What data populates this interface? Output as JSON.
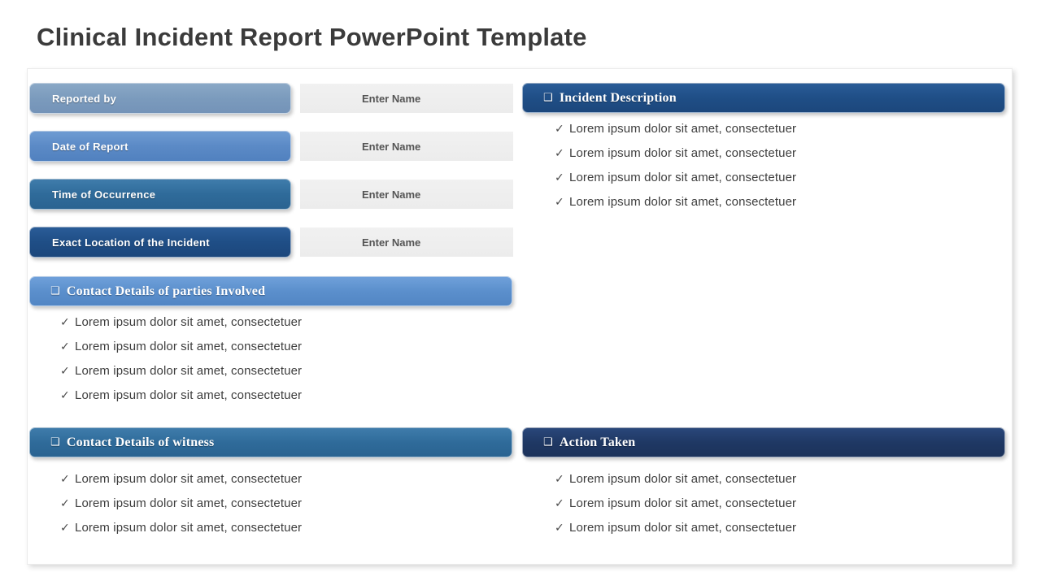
{
  "title": "Clinical Incident Report PowerPoint Template",
  "fields": [
    {
      "label": "Reported by",
      "value": "Enter Name",
      "placeholder": "Enter Name",
      "color": "#7b9bbd"
    },
    {
      "label": "Date of Report",
      "value": "Enter Name",
      "placeholder": "Enter Name",
      "color": "#5b8ac6"
    },
    {
      "label": "Time of Occurrence",
      "value": "Enter Name",
      "placeholder": "Enter Name",
      "color": "#2f6b9a"
    },
    {
      "label": "Exact Location of the Incident",
      "value": "Enter Name",
      "placeholder": "Enter Name",
      "color": "#1f4e86"
    }
  ],
  "sections": {
    "incident_description": {
      "checkbox_glyph": "❑",
      "title": "Incident Description",
      "color": "#1f4e86",
      "bullet_glyph": "✓",
      "items": [
        "Lorem ipsum dolor sit amet, consectetuer",
        "Lorem ipsum dolor sit amet, consectetuer",
        "Lorem ipsum dolor sit amet, consectetuer",
        "Lorem ipsum dolor sit amet, consectetuer"
      ]
    },
    "contact_parties": {
      "checkbox_glyph": "❑",
      "title": "Contact Details of parties Involved",
      "color": "#5b8fcc",
      "bullet_glyph": "✓",
      "items": [
        "Lorem ipsum dolor sit amet, consectetuer",
        "Lorem ipsum dolor sit amet, consectetuer",
        "Lorem ipsum dolor sit amet, consectetuer",
        "Lorem ipsum dolor sit amet, consectetuer"
      ]
    },
    "contact_witness": {
      "checkbox_glyph": "❑",
      "title": "Contact Details of witness",
      "color": "#2f6b9a",
      "bullet_glyph": "✓",
      "items": [
        "Lorem ipsum dolor sit amet, consectetuer",
        "Lorem ipsum dolor sit amet, consectetuer",
        "Lorem ipsum dolor sit amet, consectetuer"
      ]
    },
    "action_taken": {
      "checkbox_glyph": "❑",
      "title": "Action Taken",
      "color": "#1f3864",
      "bullet_glyph": "✓",
      "items": [
        "Lorem ipsum dolor sit amet, consectetuer",
        "Lorem ipsum dolor sit amet, consectetuer",
        "Lorem ipsum dolor sit amet, consectetuer"
      ]
    }
  }
}
